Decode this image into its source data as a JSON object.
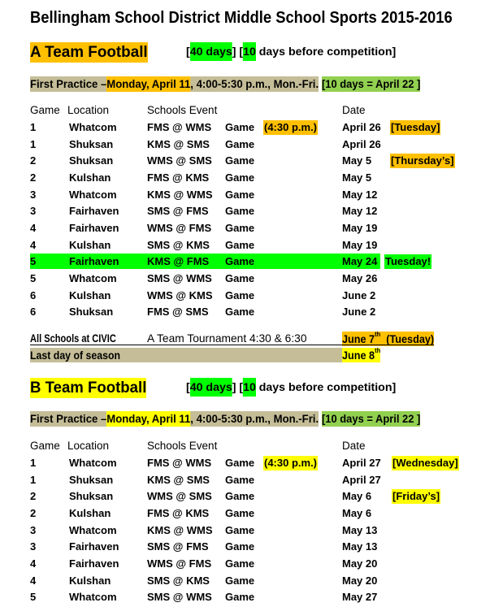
{
  "colors": {
    "orange": "#FFC000",
    "bright_green": "#00FF00",
    "light_green": "#92D050",
    "tan": "#C4BD97",
    "yellow": "#FFFF00"
  },
  "title": "Bellingham School District Middle School Sports 2015-2016",
  "a_team": {
    "heading": "A Team Football",
    "duration": {
      "open": "[",
      "days40": "40 days",
      "mid": "] [",
      "days10": "10",
      "rest": " days before competition]"
    },
    "first_practice": {
      "label": "First Practice –",
      "date": "Monday, April 11",
      "rest": ", 4:00-5:30 p.m., Mon.-Fri.",
      "tryout": "[10 days = April 22 ]"
    },
    "columns": {
      "game": "Game",
      "location": "Location",
      "schools": "Schools",
      "event": "Event",
      "date": "Date"
    },
    "rows": [
      {
        "game": "1",
        "location": "Whatcom",
        "schools": "FMS @ WMS",
        "event": "Game",
        "note": "(4:30 p.m.)",
        "date": "April 26",
        "day": "[Tuesday]"
      },
      {
        "game": "1",
        "location": "Shuksan",
        "schools": "KMS @ SMS",
        "event": "Game",
        "date": "April 26"
      },
      {
        "game": "2",
        "location": "Shuksan",
        "schools": "WMS @ SMS",
        "event": "Game",
        "date": "May 5",
        "day": "[Thursday’s]"
      },
      {
        "game": "2",
        "location": "Kulshan",
        "schools": "FMS @ KMS",
        "event": "Game",
        "date": "May 5"
      },
      {
        "game": "3",
        "location": "Whatcom",
        "schools": "KMS @ WMS",
        "event": "Game",
        "date": "May 12"
      },
      {
        "game": "3",
        "location": "Fairhaven",
        "schools": "SMS @ FMS",
        "event": "Game",
        "date": "May 12"
      },
      {
        "game": "4",
        "location": "Fairhaven",
        "schools": "WMS @ FMS",
        "event": "Game",
        "date": "May 19"
      },
      {
        "game": "4",
        "location": "Kulshan",
        "schools": "SMS @ KMS",
        "event": "Game",
        "date": "May 19"
      },
      {
        "game": "5",
        "location": "Fairhaven",
        "schools": "KMS @ FMS",
        "event": "Game",
        "date": "May 24",
        "day": "Tuesday!"
      },
      {
        "game": "5",
        "location": "Whatcom",
        "schools": "SMS @ WMS",
        "event": "Game",
        "date": "May 26"
      },
      {
        "game": "6",
        "location": "Kulshan",
        "schools": "WMS @ KMS",
        "event": "Game",
        "date": "June 2"
      },
      {
        "game": "6",
        "location": "Shuksan",
        "schools": "FMS @ SMS",
        "event": "Game",
        "date": "June 2"
      }
    ],
    "tournament": {
      "location": "All Schools at CIVIC",
      "event": "A Team Tournament 4:30 & 6:30",
      "date": "June 7",
      "date_sup": "th",
      "day": "(Tuesday)"
    },
    "last_day": {
      "label": "Last day of season",
      "date": "June 8",
      "date_sup": "th"
    }
  },
  "b_team": {
    "heading": "B Team Football",
    "duration": {
      "open": "[",
      "days40": "40 days",
      "mid": "] [",
      "days10": "10",
      "rest": " days before competition]"
    },
    "first_practice": {
      "label": "First Practice –",
      "date": "Monday, April 11",
      "rest": ", 4:00-5:30 p.m., Mon.-Fri.",
      "tryout": "[10 days = April 22 ]"
    },
    "columns": {
      "game": "Game",
      "location": "Location",
      "schools": "Schools",
      "event": "Event",
      "date": "Date"
    },
    "rows": [
      {
        "game": "1",
        "location": "Whatcom",
        "schools": "FMS @ WMS",
        "event": "Game",
        "note": "(4:30 p.m.)",
        "date": "April 27",
        "day": "[Wednesday]"
      },
      {
        "game": "1",
        "location": "Shuksan",
        "schools": "KMS @ SMS",
        "event": "Game",
        "date": "April 27"
      },
      {
        "game": "2",
        "location": "Shuksan",
        "schools": "WMS @ SMS",
        "event": "Game",
        "date": "May 6",
        "day": "[Friday’s]"
      },
      {
        "game": "2",
        "location": "Kulshan",
        "schools": "FMS @ KMS",
        "event": "Game",
        "date": "May 6"
      },
      {
        "game": "3",
        "location": "Whatcom",
        "schools": "KMS @ WMS",
        "event": "Game",
        "date": "May 13"
      },
      {
        "game": "3",
        "location": "Fairhaven",
        "schools": "SMS @ FMS",
        "event": "Game",
        "date": "May 13"
      },
      {
        "game": "4",
        "location": "Fairhaven",
        "schools": "WMS @ FMS",
        "event": "Game",
        "date": "May 20"
      },
      {
        "game": "4",
        "location": "Kulshan",
        "schools": "SMS @ KMS",
        "event": "Game",
        "date": "May 20"
      },
      {
        "game": "5",
        "location": "Whatcom",
        "schools": "SMS @ WMS",
        "event": "Game",
        "date": "May 27"
      }
    ]
  }
}
